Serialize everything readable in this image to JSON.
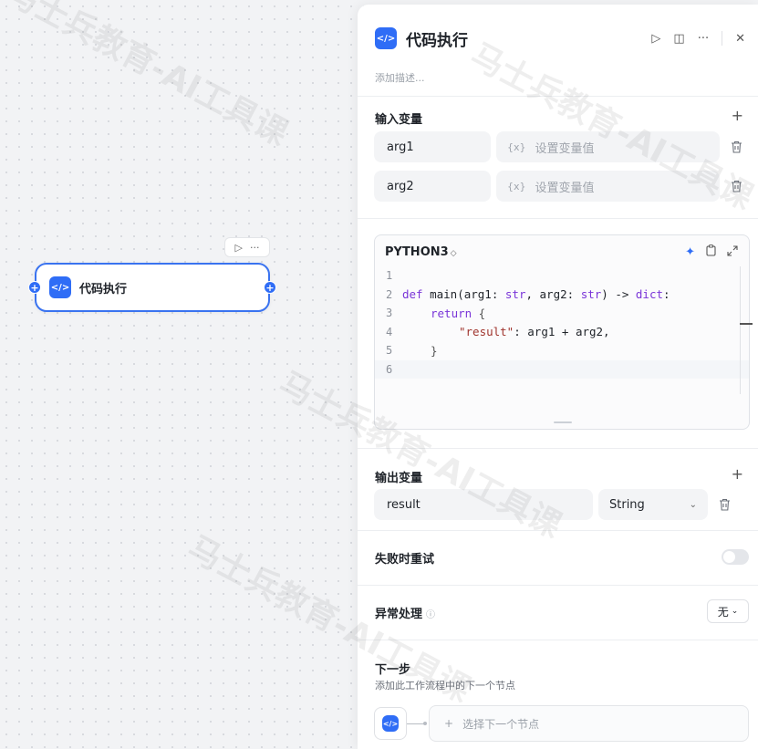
{
  "canvas": {
    "node": {
      "title": "代码执行",
      "icon": "code-icon",
      "icon_glyph": "</>"
    },
    "toolbar": {
      "run_glyph": "▷",
      "more_glyph": "···"
    }
  },
  "panel": {
    "icon_glyph": "</>",
    "title": "代码执行",
    "actions": {
      "run": "▷",
      "split": "◫",
      "more": "···",
      "close": "✕"
    },
    "description_placeholder": "添加描述...",
    "input_section": {
      "title": "输入变量",
      "add": "+",
      "variables": [
        {
          "name": "arg1",
          "value_prefix": "{x}",
          "value_placeholder": "设置变量值"
        },
        {
          "name": "arg2",
          "value_prefix": "{x}",
          "value_placeholder": "设置变量值"
        }
      ]
    },
    "code_editor": {
      "language": "PYTHON3",
      "language_caret": "◇",
      "lines": [
        "1",
        "2",
        "3",
        "4",
        "5",
        "6"
      ],
      "code": {
        "l2_kw": "def",
        "l2_fn": " main(arg1: ",
        "l2_ty1": "str",
        "l2_mid": ", arg2: ",
        "l2_ty2": "str",
        "l2_arrow": ") -> ",
        "l2_ty3": "dict",
        "l2_end": ":",
        "l3_kw": "return",
        "l3_brace": " {",
        "l4_str": "\"result\"",
        "l4_rest": ": arg1 + arg2,",
        "l5": "}"
      }
    },
    "output_section": {
      "title": "输出变量",
      "add": "+",
      "variables": [
        {
          "name": "result",
          "type": "String"
        }
      ]
    },
    "retry": {
      "label": "失败时重试",
      "enabled": false
    },
    "exception": {
      "label": "异常处理",
      "info": "ⓘ",
      "value": "无"
    },
    "next_step": {
      "title": "下一步",
      "description": "添加此工作流程中的下一个节点",
      "choose_label": "选择下一个节点",
      "choose_plus": "+"
    }
  },
  "watermark": "马士兵教育-AI工具课",
  "colors": {
    "accent": "#2f6df6",
    "node_border": "#3a73f0",
    "keyword": "#7a35d8",
    "string": "#a0352e"
  }
}
